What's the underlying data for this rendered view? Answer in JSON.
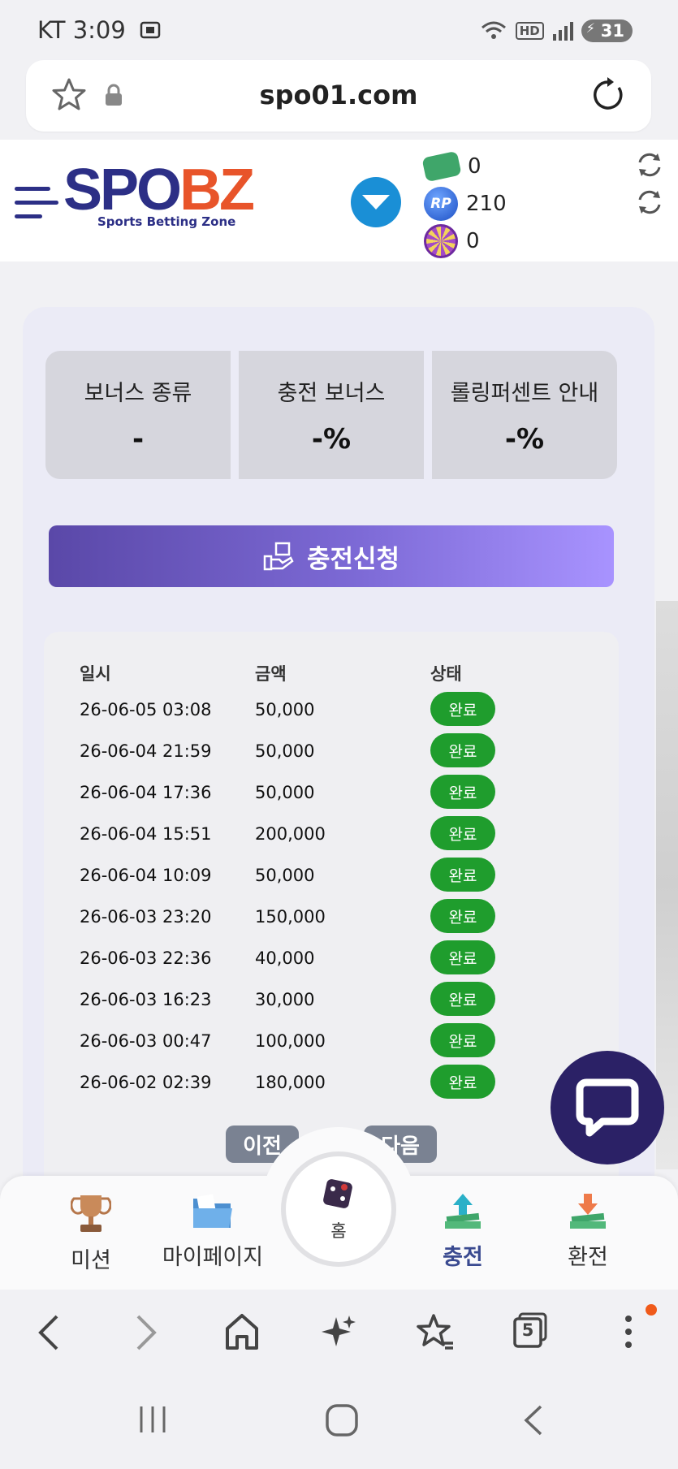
{
  "status_bar": {
    "carrier_time": "KT 3:09",
    "hd_label": "HD",
    "battery": "31"
  },
  "browser": {
    "url": "spo01.com"
  },
  "header": {
    "logo_primary": "SPO",
    "logo_accent": "BZ",
    "logo_tagline": "Sports Betting Zone",
    "balances": [
      {
        "icon": "cash-icon",
        "value": "0"
      },
      {
        "icon": "rolling-point-icon",
        "label": "RP",
        "value": "210"
      },
      {
        "icon": "dartboard-icon",
        "value": "0"
      }
    ]
  },
  "bonus": [
    {
      "label": "보너스 종류",
      "value": "-"
    },
    {
      "label": "충전 보너스",
      "value": "-%"
    },
    {
      "label": "롤링퍼센트 안내",
      "value": "-%"
    }
  ],
  "charge_button_label": "충전신청",
  "history": {
    "columns": [
      "일시",
      "금액",
      "상태"
    ],
    "rows": [
      {
        "date": "26-06-05 03:08",
        "amount": "50,000",
        "status": "완료"
      },
      {
        "date": "26-06-04 21:59",
        "amount": "50,000",
        "status": "완료"
      },
      {
        "date": "26-06-04 17:36",
        "amount": "50,000",
        "status": "완료"
      },
      {
        "date": "26-06-04 15:51",
        "amount": "200,000",
        "status": "완료"
      },
      {
        "date": "26-06-04 10:09",
        "amount": "50,000",
        "status": "완료"
      },
      {
        "date": "26-06-03 23:20",
        "amount": "150,000",
        "status": "완료"
      },
      {
        "date": "26-06-03 22:36",
        "amount": "40,000",
        "status": "완료"
      },
      {
        "date": "26-06-03 16:23",
        "amount": "30,000",
        "status": "완료"
      },
      {
        "date": "26-06-03 00:47",
        "amount": "100,000",
        "status": "완료"
      },
      {
        "date": "26-06-02 02:39",
        "amount": "180,000",
        "status": "완료"
      }
    ]
  },
  "pagination": {
    "prev": "이전",
    "next": "다음"
  },
  "site_nav": {
    "mission": "미션",
    "mypage": "마이페이지",
    "home": "홈",
    "charge": "충전",
    "exchange": "환전"
  },
  "browser_tabs_count": "5",
  "colors": {
    "brand_navy": "#2c2f86",
    "brand_orange": "#e8542a",
    "status_green": "#1f9d2d",
    "charge_purple": "#7d6ad6"
  }
}
